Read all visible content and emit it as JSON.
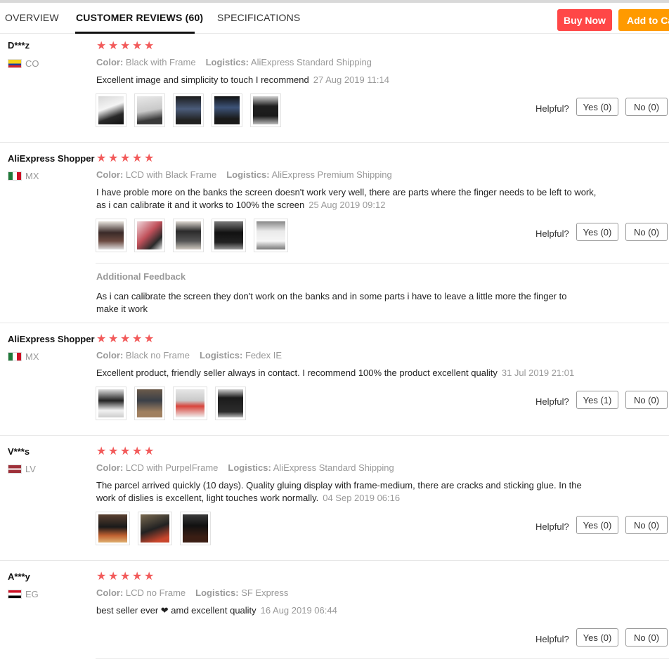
{
  "tabs": {
    "overview": "OVERVIEW",
    "reviews": "CUSTOMER REVIEWS (60)",
    "specs": "SPECIFICATIONS"
  },
  "actions": {
    "buy_now": "Buy Now",
    "add_to_cart": "Add to Ca"
  },
  "labels": {
    "color": "Color:",
    "logistics": "Logistics:",
    "helpful": "Helpful?",
    "additional_feedback": "Additional Feedback"
  },
  "colors": {
    "star": "#f25a5a",
    "buy_now": "#ff4747",
    "add_to_cart": "#ff9a00"
  },
  "reviews": [
    {
      "user": "D***z",
      "country": "CO",
      "flag": "flag-co",
      "rating": 5,
      "color": "Black with Frame",
      "logistics": "AliExpress Standard Shipping",
      "text": "Excellent image and simplicity to touch I recommend",
      "date": "27 Aug 2019 11:14",
      "yes": "Yes (0)",
      "no": "No (0)",
      "photos": 5
    },
    {
      "user": "AliExpress Shopper",
      "country": "MX",
      "flag": "flag-mx",
      "rating": 5,
      "color": "LCD with Black Frame",
      "logistics": "AliExpress Premium Shipping",
      "text": "I have proble more on the banks the screen doesn't work very well, there are parts where the finger needs to be left to work, as i can calibrate it and it works to 100% the screen",
      "date": "25 Aug 2019 09:12",
      "yes": "Yes (0)",
      "no": "No (0)",
      "photos": 5,
      "additional_feedback": "As i can calibrate the screen they don't work on the banks and in some parts i have to leave a little more the finger to make it work"
    },
    {
      "user": "AliExpress Shopper",
      "country": "MX",
      "flag": "flag-mx",
      "rating": 5,
      "color": "Black no Frame",
      "logistics": "Fedex IE",
      "text": "Excellent product, friendly seller always in contact. I recommend 100% the product excellent quality",
      "date": "31 Jul 2019 21:01",
      "yes": "Yes (1)",
      "no": "No (0)",
      "photos": 4
    },
    {
      "user": "V***s",
      "country": "LV",
      "flag": "flag-lv",
      "rating": 5,
      "color": "LCD with PurpelFrame",
      "logistics": "AliExpress Standard Shipping",
      "text": "The parcel arrived quickly (10 days). Quality gluing display with frame-medium, there are cracks and sticking glue. In the work of dislies is excellent, light touches work normally.",
      "date": "04 Sep 2019 06:16",
      "yes": "Yes (0)",
      "no": "No (0)",
      "photos": 3
    },
    {
      "user": "A***y",
      "country": "EG",
      "flag": "flag-eg",
      "rating": 5,
      "color": "LCD no Frame",
      "logistics": "SF Express",
      "text": "best seller ever ❤ amd excellent quality",
      "date": "16 Aug 2019 06:44",
      "yes": "Yes (0)",
      "no": "No (0)",
      "photos": 0
    }
  ]
}
